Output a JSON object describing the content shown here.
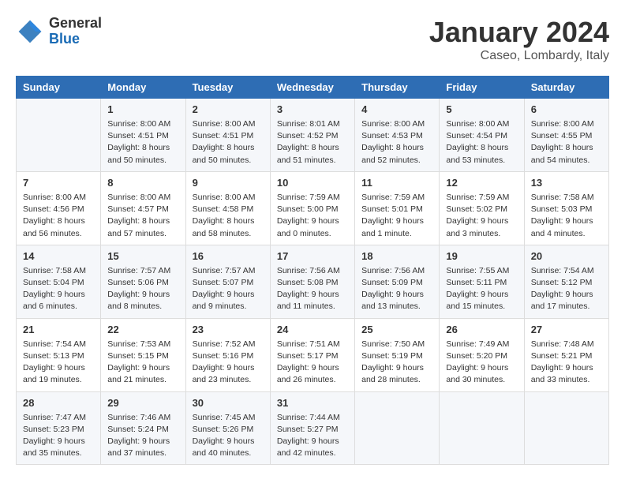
{
  "header": {
    "logo_general": "General",
    "logo_blue": "Blue",
    "month_title": "January 2024",
    "location": "Caseo, Lombardy, Italy"
  },
  "weekdays": [
    "Sunday",
    "Monday",
    "Tuesday",
    "Wednesday",
    "Thursday",
    "Friday",
    "Saturday"
  ],
  "weeks": [
    [
      {
        "day": "",
        "sunrise": "",
        "sunset": "",
        "daylight": ""
      },
      {
        "day": "1",
        "sunrise": "Sunrise: 8:00 AM",
        "sunset": "Sunset: 4:51 PM",
        "daylight": "Daylight: 8 hours and 50 minutes."
      },
      {
        "day": "2",
        "sunrise": "Sunrise: 8:00 AM",
        "sunset": "Sunset: 4:51 PM",
        "daylight": "Daylight: 8 hours and 50 minutes."
      },
      {
        "day": "3",
        "sunrise": "Sunrise: 8:01 AM",
        "sunset": "Sunset: 4:52 PM",
        "daylight": "Daylight: 8 hours and 51 minutes."
      },
      {
        "day": "4",
        "sunrise": "Sunrise: 8:00 AM",
        "sunset": "Sunset: 4:53 PM",
        "daylight": "Daylight: 8 hours and 52 minutes."
      },
      {
        "day": "5",
        "sunrise": "Sunrise: 8:00 AM",
        "sunset": "Sunset: 4:54 PM",
        "daylight": "Daylight: 8 hours and 53 minutes."
      },
      {
        "day": "6",
        "sunrise": "Sunrise: 8:00 AM",
        "sunset": "Sunset: 4:55 PM",
        "daylight": "Daylight: 8 hours and 54 minutes."
      }
    ],
    [
      {
        "day": "7",
        "sunrise": "Sunrise: 8:00 AM",
        "sunset": "Sunset: 4:56 PM",
        "daylight": "Daylight: 8 hours and 56 minutes."
      },
      {
        "day": "8",
        "sunrise": "Sunrise: 8:00 AM",
        "sunset": "Sunset: 4:57 PM",
        "daylight": "Daylight: 8 hours and 57 minutes."
      },
      {
        "day": "9",
        "sunrise": "Sunrise: 8:00 AM",
        "sunset": "Sunset: 4:58 PM",
        "daylight": "Daylight: 8 hours and 58 minutes."
      },
      {
        "day": "10",
        "sunrise": "Sunrise: 7:59 AM",
        "sunset": "Sunset: 5:00 PM",
        "daylight": "Daylight: 9 hours and 0 minutes."
      },
      {
        "day": "11",
        "sunrise": "Sunrise: 7:59 AM",
        "sunset": "Sunset: 5:01 PM",
        "daylight": "Daylight: 9 hours and 1 minute."
      },
      {
        "day": "12",
        "sunrise": "Sunrise: 7:59 AM",
        "sunset": "Sunset: 5:02 PM",
        "daylight": "Daylight: 9 hours and 3 minutes."
      },
      {
        "day": "13",
        "sunrise": "Sunrise: 7:58 AM",
        "sunset": "Sunset: 5:03 PM",
        "daylight": "Daylight: 9 hours and 4 minutes."
      }
    ],
    [
      {
        "day": "14",
        "sunrise": "Sunrise: 7:58 AM",
        "sunset": "Sunset: 5:04 PM",
        "daylight": "Daylight: 9 hours and 6 minutes."
      },
      {
        "day": "15",
        "sunrise": "Sunrise: 7:57 AM",
        "sunset": "Sunset: 5:06 PM",
        "daylight": "Daylight: 9 hours and 8 minutes."
      },
      {
        "day": "16",
        "sunrise": "Sunrise: 7:57 AM",
        "sunset": "Sunset: 5:07 PM",
        "daylight": "Daylight: 9 hours and 9 minutes."
      },
      {
        "day": "17",
        "sunrise": "Sunrise: 7:56 AM",
        "sunset": "Sunset: 5:08 PM",
        "daylight": "Daylight: 9 hours and 11 minutes."
      },
      {
        "day": "18",
        "sunrise": "Sunrise: 7:56 AM",
        "sunset": "Sunset: 5:09 PM",
        "daylight": "Daylight: 9 hours and 13 minutes."
      },
      {
        "day": "19",
        "sunrise": "Sunrise: 7:55 AM",
        "sunset": "Sunset: 5:11 PM",
        "daylight": "Daylight: 9 hours and 15 minutes."
      },
      {
        "day": "20",
        "sunrise": "Sunrise: 7:54 AM",
        "sunset": "Sunset: 5:12 PM",
        "daylight": "Daylight: 9 hours and 17 minutes."
      }
    ],
    [
      {
        "day": "21",
        "sunrise": "Sunrise: 7:54 AM",
        "sunset": "Sunset: 5:13 PM",
        "daylight": "Daylight: 9 hours and 19 minutes."
      },
      {
        "day": "22",
        "sunrise": "Sunrise: 7:53 AM",
        "sunset": "Sunset: 5:15 PM",
        "daylight": "Daylight: 9 hours and 21 minutes."
      },
      {
        "day": "23",
        "sunrise": "Sunrise: 7:52 AM",
        "sunset": "Sunset: 5:16 PM",
        "daylight": "Daylight: 9 hours and 23 minutes."
      },
      {
        "day": "24",
        "sunrise": "Sunrise: 7:51 AM",
        "sunset": "Sunset: 5:17 PM",
        "daylight": "Daylight: 9 hours and 26 minutes."
      },
      {
        "day": "25",
        "sunrise": "Sunrise: 7:50 AM",
        "sunset": "Sunset: 5:19 PM",
        "daylight": "Daylight: 9 hours and 28 minutes."
      },
      {
        "day": "26",
        "sunrise": "Sunrise: 7:49 AM",
        "sunset": "Sunset: 5:20 PM",
        "daylight": "Daylight: 9 hours and 30 minutes."
      },
      {
        "day": "27",
        "sunrise": "Sunrise: 7:48 AM",
        "sunset": "Sunset: 5:21 PM",
        "daylight": "Daylight: 9 hours and 33 minutes."
      }
    ],
    [
      {
        "day": "28",
        "sunrise": "Sunrise: 7:47 AM",
        "sunset": "Sunset: 5:23 PM",
        "daylight": "Daylight: 9 hours and 35 minutes."
      },
      {
        "day": "29",
        "sunrise": "Sunrise: 7:46 AM",
        "sunset": "Sunset: 5:24 PM",
        "daylight": "Daylight: 9 hours and 37 minutes."
      },
      {
        "day": "30",
        "sunrise": "Sunrise: 7:45 AM",
        "sunset": "Sunset: 5:26 PM",
        "daylight": "Daylight: 9 hours and 40 minutes."
      },
      {
        "day": "31",
        "sunrise": "Sunrise: 7:44 AM",
        "sunset": "Sunset: 5:27 PM",
        "daylight": "Daylight: 9 hours and 42 minutes."
      },
      {
        "day": "",
        "sunrise": "",
        "sunset": "",
        "daylight": ""
      },
      {
        "day": "",
        "sunrise": "",
        "sunset": "",
        "daylight": ""
      },
      {
        "day": "",
        "sunrise": "",
        "sunset": "",
        "daylight": ""
      }
    ]
  ]
}
